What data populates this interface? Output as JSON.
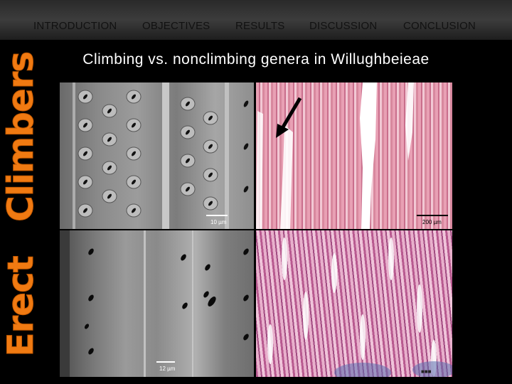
{
  "nav": {
    "items": [
      "INTRODUCTION",
      "OBJECTIVES",
      "RESULTS",
      "DISCUSSION",
      "CONCLUSION"
    ]
  },
  "title": "Climbing vs. nonclimbing genera in Willughbeieae",
  "side_labels": {
    "top": "Climbers",
    "bottom": "Erect"
  },
  "scale_labels": {
    "sem_top": "10 µm",
    "lm_top": "200 µm",
    "sem_bottom": "12 µm"
  }
}
